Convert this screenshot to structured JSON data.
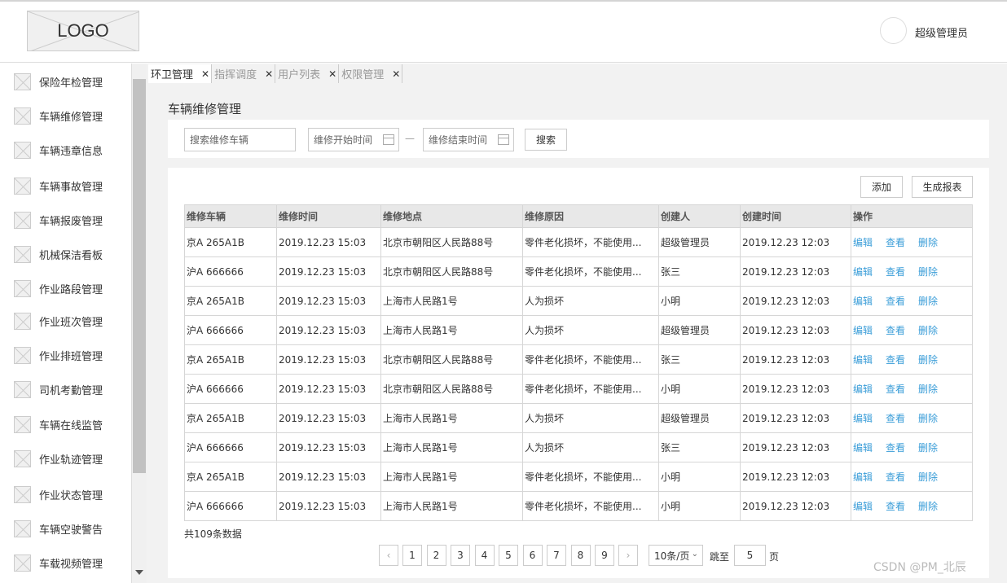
{
  "header": {
    "logo_text": "LOGO",
    "username": "超级管理员"
  },
  "sidebar": {
    "items": [
      {
        "label": "保险年检管理"
      },
      {
        "label": "车辆维修管理"
      },
      {
        "label": "车辆违章信息"
      },
      {
        "label": "车辆事故管理"
      },
      {
        "label": "车辆报废管理"
      },
      {
        "label": "机械保洁看板"
      },
      {
        "label": "作业路段管理"
      },
      {
        "label": "作业班次管理"
      },
      {
        "label": "作业排班管理"
      },
      {
        "label": "司机考勤管理"
      },
      {
        "label": "车辆在线监管"
      },
      {
        "label": "作业轨迹管理"
      },
      {
        "label": "作业状态管理"
      },
      {
        "label": "车辆空驶警告"
      },
      {
        "label": "车载视频管理"
      }
    ]
  },
  "tabs": [
    {
      "label": "环卫管理",
      "close": "✕"
    },
    {
      "label": "指挥调度",
      "close": "✕"
    },
    {
      "label": "用户列表",
      "close": "✕"
    },
    {
      "label": "权限管理",
      "close": "✕"
    }
  ],
  "page": {
    "title": "车辆维修管理"
  },
  "filter": {
    "search_placeholder": "搜索维修车辆",
    "start_placeholder": "维修开始时间",
    "dash": "—",
    "end_placeholder": "维修结束时间",
    "search_button": "搜索"
  },
  "toolbar": {
    "add_button": "添加",
    "report_button": "生成报表"
  },
  "table": {
    "headers": [
      "维修车辆",
      "维修时间",
      "维修地点",
      "维修原因",
      "创建人",
      "创建时间",
      "操作"
    ],
    "ops": [
      "编辑",
      "查看",
      "删除"
    ],
    "rows": [
      [
        "京A 265A1B",
        "2019.12.23 15:03",
        "北京市朝阳区人民路88号",
        "零件老化损坏，不能使用...",
        "超级管理员",
        "2019.12.23 12:03"
      ],
      [
        "沪A 666666",
        "2019.12.23 15:03",
        "北京市朝阳区人民路88号",
        "零件老化损坏，不能使用...",
        "张三",
        "2019.12.23 12:03"
      ],
      [
        "京A 265A1B",
        "2019.12.23 15:03",
        "上海市人民路1号",
        "人为损坏",
        "小明",
        "2019.12.23 12:03"
      ],
      [
        "沪A 666666",
        "2019.12.23 15:03",
        "上海市人民路1号",
        "人为损坏",
        "超级管理员",
        "2019.12.23 12:03"
      ],
      [
        "京A 265A1B",
        "2019.12.23 15:03",
        "北京市朝阳区人民路88号",
        "零件老化损坏，不能使用...",
        "张三",
        "2019.12.23 12:03"
      ],
      [
        "沪A 666666",
        "2019.12.23 15:03",
        "北京市朝阳区人民路88号",
        "零件老化损坏，不能使用...",
        "小明",
        "2019.12.23 12:03"
      ],
      [
        "京A 265A1B",
        "2019.12.23 15:03",
        "上海市人民路1号",
        "人为损坏",
        "超级管理员",
        "2019.12.23 12:03"
      ],
      [
        "沪A 666666",
        "2019.12.23 15:03",
        "上海市人民路1号",
        "人为损坏",
        "张三",
        "2019.12.23 12:03"
      ],
      [
        "京A 265A1B",
        "2019.12.23 15:03",
        "上海市人民路1号",
        "零件老化损坏，不能使用...",
        "小明",
        "2019.12.23 12:03"
      ],
      [
        "沪A 666666",
        "2019.12.23 15:03",
        "上海市人民路1号",
        "零件老化损坏，不能使用...",
        "小明",
        "2019.12.23 12:03"
      ]
    ],
    "total": "共109条数据"
  },
  "pagination": {
    "prev": "‹",
    "next": "›",
    "pages": [
      "1",
      "2",
      "3",
      "4",
      "5",
      "6",
      "7",
      "8",
      "9"
    ],
    "page_size": "10条/页",
    "jump_label": "跳至",
    "jump_value": "5",
    "page_suffix": "页"
  },
  "watermark": "CSDN @PM_北辰"
}
